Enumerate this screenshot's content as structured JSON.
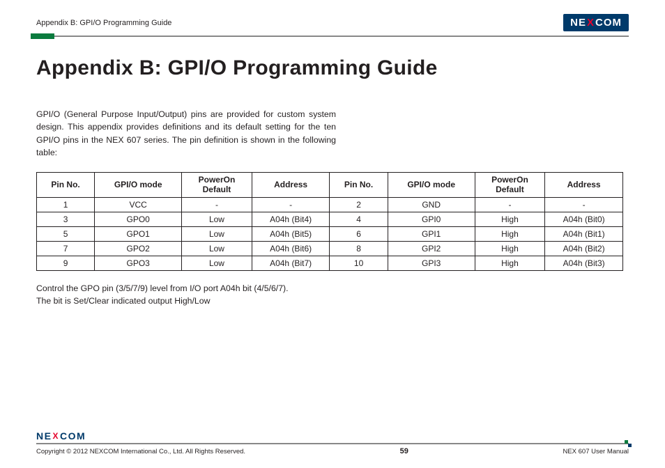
{
  "header": {
    "section": "Appendix B: GPI/O Programming Guide",
    "logo": {
      "pre": "NE",
      "x": "X",
      "post": "COM"
    }
  },
  "title": "Appendix B: GPI/O Programming Guide",
  "intro": "GPI/O (General Purpose Input/Output) pins are provided for custom system design. This appendix provides definitions and its default setting for the ten GPI/O pins in the NEX 607 series. The pin definition is shown in the following table:",
  "table": {
    "headers": [
      "Pin No.",
      "GPI/O mode",
      "PowerOn Default",
      "Address",
      "Pin No.",
      "GPI/O mode",
      "PowerOn Default",
      "Address"
    ],
    "rows": [
      [
        "1",
        "VCC",
        "-",
        "-",
        "2",
        "GND",
        "-",
        "-"
      ],
      [
        "3",
        "GPO0",
        "Low",
        "A04h (Bit4)",
        "4",
        "GPI0",
        "High",
        "A04h (Bit0)"
      ],
      [
        "5",
        "GPO1",
        "Low",
        "A04h (Bit5)",
        "6",
        "GPI1",
        "High",
        "A04h (Bit1)"
      ],
      [
        "7",
        "GPO2",
        "Low",
        "A04h (Bit6)",
        "8",
        "GPI2",
        "High",
        "A04h (Bit2)"
      ],
      [
        "9",
        "GPO3",
        "Low",
        "A04h (Bit7)",
        "10",
        "GPI3",
        "High",
        "A04h (Bit3)"
      ]
    ]
  },
  "after": {
    "line1": "Control the GPO pin (3/5/7/9) level from I/O port A04h bit (4/5/6/7).",
    "line2": "The bit is Set/Clear indicated output High/Low"
  },
  "footer": {
    "copyright": "Copyright © 2012 NEXCOM International Co., Ltd. All Rights Reserved.",
    "page": "59",
    "doc": "NEX 607 User Manual",
    "logo": {
      "pre": "NE",
      "x": "X",
      "post": "COM"
    }
  },
  "chart_data": {
    "type": "table",
    "title": "GPI/O Pin Definition — NEX 607",
    "columns": [
      "Pin No.",
      "GPI/O mode",
      "PowerOn Default",
      "Address"
    ],
    "rows": [
      {
        "Pin No.": 1,
        "GPI/O mode": "VCC",
        "PowerOn Default": null,
        "Address": null
      },
      {
        "Pin No.": 2,
        "GPI/O mode": "GND",
        "PowerOn Default": null,
        "Address": null
      },
      {
        "Pin No.": 3,
        "GPI/O mode": "GPO0",
        "PowerOn Default": "Low",
        "Address": "A04h (Bit4)"
      },
      {
        "Pin No.": 4,
        "GPI/O mode": "GPI0",
        "PowerOn Default": "High",
        "Address": "A04h (Bit0)"
      },
      {
        "Pin No.": 5,
        "GPI/O mode": "GPO1",
        "PowerOn Default": "Low",
        "Address": "A04h (Bit5)"
      },
      {
        "Pin No.": 6,
        "GPI/O mode": "GPI1",
        "PowerOn Default": "High",
        "Address": "A04h (Bit1)"
      },
      {
        "Pin No.": 7,
        "GPI/O mode": "GPO2",
        "PowerOn Default": "Low",
        "Address": "A04h (Bit6)"
      },
      {
        "Pin No.": 8,
        "GPI/O mode": "GPI2",
        "PowerOn Default": "High",
        "Address": "A04h (Bit2)"
      },
      {
        "Pin No.": 9,
        "GPI/O mode": "GPO3",
        "PowerOn Default": "Low",
        "Address": "A04h (Bit7)"
      },
      {
        "Pin No.": 10,
        "GPI/O mode": "GPI3",
        "PowerOn Default": "High",
        "Address": "A04h (Bit3)"
      }
    ]
  }
}
